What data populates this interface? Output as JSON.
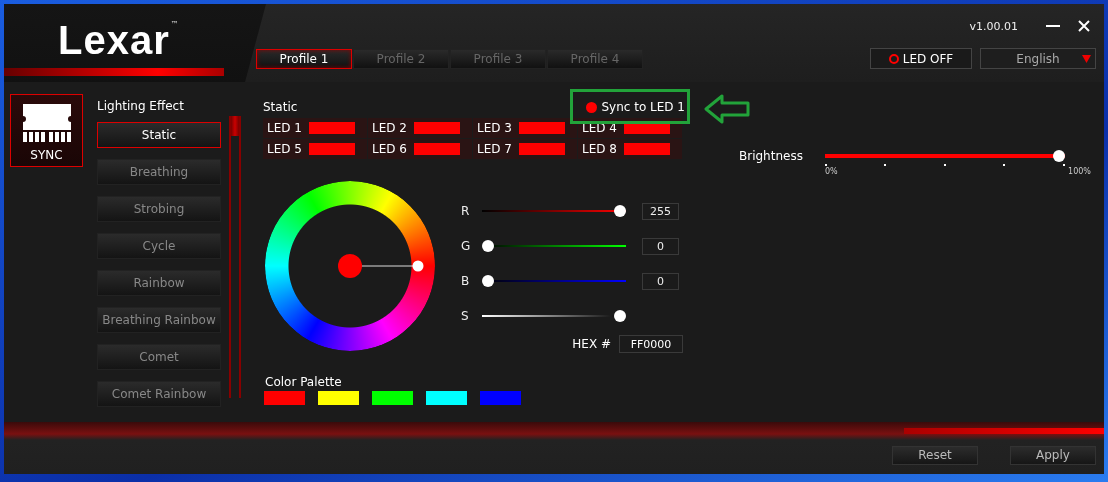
{
  "logo": {
    "text": "Lexar",
    "trademark": "™"
  },
  "version": "v1.00.01",
  "profiles": [
    {
      "label": "Profile 1",
      "selected": true
    },
    {
      "label": "Profile 2",
      "selected": false
    },
    {
      "label": "Profile 3",
      "selected": false
    },
    {
      "label": "Profile 4",
      "selected": false
    }
  ],
  "led_off_button": {
    "label": "LED OFF"
  },
  "language_select": {
    "value": "English"
  },
  "sync_button": {
    "label": "SYNC",
    "selected": true
  },
  "lighting_effect": {
    "title": "Lighting Effect",
    "effects": [
      {
        "label": "Static",
        "selected": true
      },
      {
        "label": "Breathing",
        "selected": false
      },
      {
        "label": "Strobing",
        "selected": false
      },
      {
        "label": "Cycle",
        "selected": false
      },
      {
        "label": "Rainbow",
        "selected": false
      },
      {
        "label": "Breathing Rainbow",
        "selected": false
      },
      {
        "label": "Comet",
        "selected": false
      },
      {
        "label": "Comet Rainbow",
        "selected": false
      }
    ]
  },
  "mode_title": "Static",
  "sync_to": {
    "label": "Sync to LED 1"
  },
  "leds": [
    {
      "label": "LED 1",
      "color": "#ff0000"
    },
    {
      "label": "LED 2",
      "color": "#ff0000"
    },
    {
      "label": "LED 3",
      "color": "#ff0000"
    },
    {
      "label": "LED 4",
      "color": "#ff0000"
    },
    {
      "label": "LED 5",
      "color": "#ff0000"
    },
    {
      "label": "LED 6",
      "color": "#ff0000"
    },
    {
      "label": "LED 7",
      "color": "#ff0000"
    },
    {
      "label": "LED 8",
      "color": "#ff0000"
    }
  ],
  "brightness": {
    "label": "Brightness",
    "level": 1,
    "min_label": "0%",
    "max_label": "100%"
  },
  "channels": [
    {
      "name": "R",
      "kind": "red",
      "level": 1,
      "value": "255"
    },
    {
      "name": "G",
      "kind": "green",
      "level": 0,
      "value": "0"
    },
    {
      "name": "B",
      "kind": "blue",
      "level": 0,
      "value": "0"
    },
    {
      "name": "S",
      "kind": "saturation",
      "level": 1
    }
  ],
  "hex": {
    "label": "HEX #",
    "value": "FF0000"
  },
  "palette": {
    "title": "Color Palette",
    "colors": [
      {
        "color": "#ff0000"
      },
      {
        "color": "#ffff00"
      },
      {
        "color": "#00ff00"
      },
      {
        "color": "#00ffff"
      },
      {
        "color": "#0000ff"
      }
    ]
  },
  "footer_buttons": [
    {
      "label": "Reset"
    },
    {
      "label": "Apply"
    }
  ]
}
